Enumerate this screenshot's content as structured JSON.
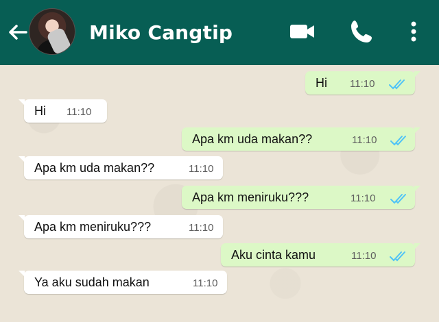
{
  "header": {
    "contact_name": "Miko Cangtip",
    "back_icon": "arrow-left-icon",
    "avatar_icon": "profile-photo",
    "video_icon": "video-camera-icon",
    "call_icon": "phone-icon",
    "menu_icon": "more-vertical-icon",
    "bar_color": "#075e54"
  },
  "messages": [
    {
      "direction": "outgoing",
      "text": "Hi",
      "time": "11:10",
      "status": "read"
    },
    {
      "direction": "incoming",
      "text": "Hi",
      "time": "11:10"
    },
    {
      "direction": "outgoing",
      "text": "Apa km uda makan??",
      "time": "11:10",
      "status": "read"
    },
    {
      "direction": "incoming",
      "text": "Apa km uda makan??",
      "time": "11:10"
    },
    {
      "direction": "outgoing",
      "text": "Apa km meniruku???",
      "time": "11:10",
      "status": "read"
    },
    {
      "direction": "incoming",
      "text": "Apa km meniruku???",
      "time": "11:10"
    },
    {
      "direction": "outgoing",
      "text": "Aku cinta kamu",
      "time": "11:10",
      "status": "read"
    },
    {
      "direction": "incoming",
      "text": "Ya aku sudah makan",
      "time": "11:10"
    }
  ],
  "colors": {
    "outgoing_bubble": "#dcf8c6",
    "incoming_bubble": "#ffffff",
    "read_ticks": "#4fc3f7",
    "chat_background": "#ebe4d7"
  }
}
